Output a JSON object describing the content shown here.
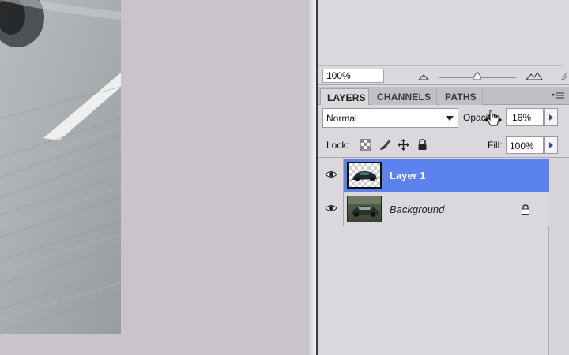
{
  "navigator": {
    "zoom_value": "100%"
  },
  "tabs": [
    {
      "label": "LAYERS"
    },
    {
      "label": "CHANNELS"
    },
    {
      "label": "PATHS"
    }
  ],
  "blend": {
    "mode": "Normal",
    "opacity_label": "Opacity:",
    "opacity_value": "16%"
  },
  "lock": {
    "label": "Lock:",
    "fill_label": "Fill:",
    "fill_value": "100%"
  },
  "layers": [
    {
      "name": "Layer 1",
      "selected": true,
      "visible": true,
      "locked": false
    },
    {
      "name": "Background",
      "selected": false,
      "visible": true,
      "locked": true
    }
  ],
  "colors": {
    "selection": "#5b82ed",
    "panel": "#dad7dd",
    "arrow": "#2b4fa8"
  }
}
